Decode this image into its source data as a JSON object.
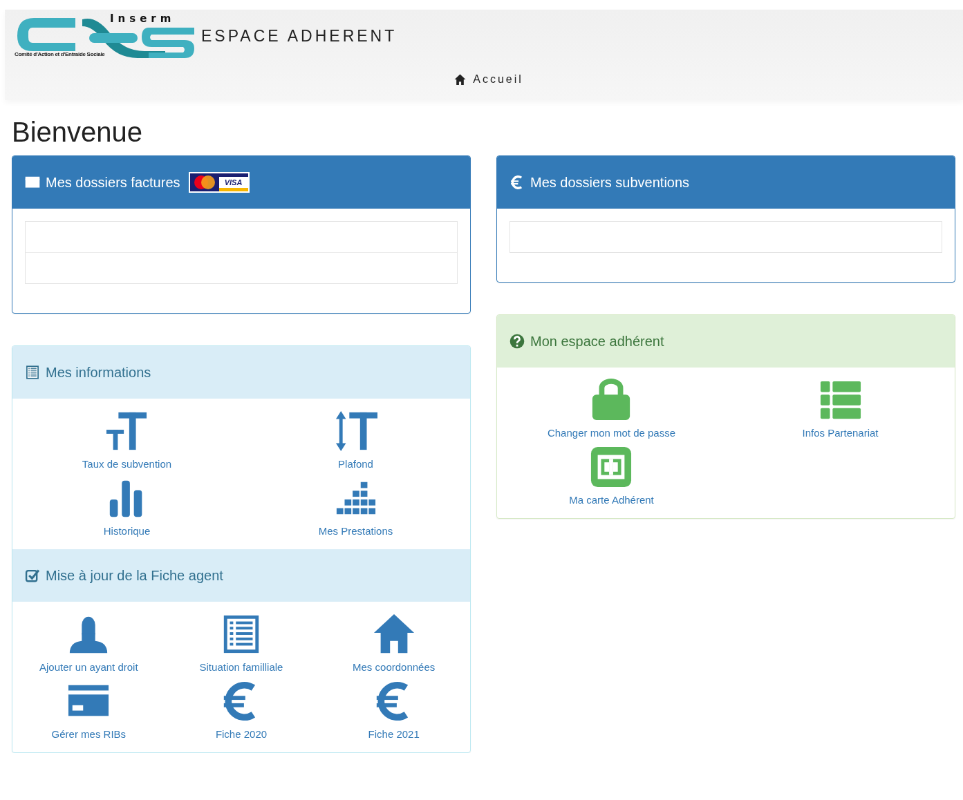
{
  "header": {
    "logo": {
      "brand": "Inserm",
      "tagline": "Comité d'Action et d'Entraide Sociale"
    },
    "title": "ESPACE ADHERENT",
    "nav": [
      {
        "label": "Accueil",
        "kind": "home"
      }
    ]
  },
  "heading": "Bienvenue",
  "columns": [
    [
      {
        "kind": "primary",
        "title": {
          "kind": "card",
          "text": "Mes dossiers factures"
        },
        "badges": [
          {
            "kind": "mastercard"
          },
          {
            "kind": "visa",
            "text": "VISA"
          }
        ],
        "rows": [
          "",
          ""
        ]
      },
      {
        "kind": "info",
        "sections": [
          {
            "title": {
              "kind": "list-alt",
              "text": "Mes informations"
            },
            "tiles": [
              {
                "kind": "text-size",
                "label": "Taux de subvention"
              },
              {
                "kind": "text-height",
                "label": "Plafond"
              },
              {
                "kind": "stats",
                "label": "Historique"
              },
              {
                "kind": "equalizer",
                "label": "Mes Prestations"
              }
            ]
          },
          {
            "title": {
              "kind": "check",
              "text": "Mise à jour de la Fiche agent"
            },
            "tiles": [
              {
                "kind": "user",
                "label": "Ajouter un ayant droit"
              },
              {
                "kind": "list-alt",
                "label": "Situation familliale"
              },
              {
                "kind": "home",
                "label": "Mes coordonnées"
              },
              {
                "kind": "card",
                "label": "Gérer mes RIBs"
              },
              {
                "kind": "euro",
                "label": "Fiche 2020"
              },
              {
                "kind": "euro",
                "label": "Fiche 2021"
              }
            ]
          }
        ]
      }
    ],
    [
      {
        "kind": "primary",
        "title": {
          "kind": "euro",
          "text": "Mes dossiers subventions"
        },
        "rows": [
          ""
        ]
      },
      {
        "kind": "success",
        "sections": [
          {
            "title": {
              "kind": "question",
              "text": "Mon espace adhérent"
            },
            "tiles": [
              {
                "kind": "lock",
                "label": "Changer mon mot de passe"
              },
              {
                "kind": "th-list",
                "label": "Infos Partenariat"
              },
              {
                "kind": "film",
                "label": "Ma carte Adhérent"
              }
            ]
          }
        ]
      }
    ]
  ]
}
